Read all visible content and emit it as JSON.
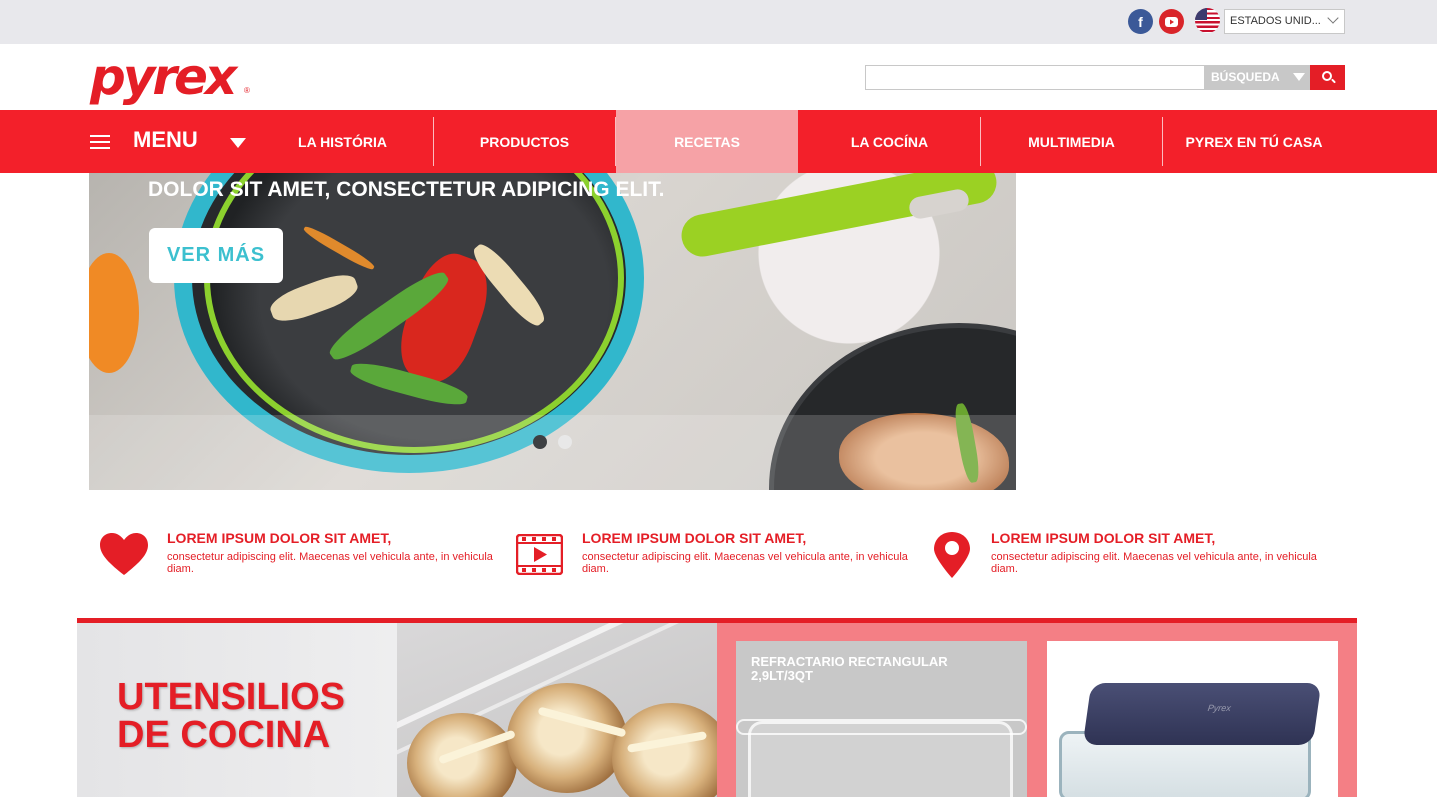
{
  "topbar": {
    "social": [
      "facebook-icon",
      "youtube-icon"
    ],
    "country_selected": "ESTADOS UNID..."
  },
  "header": {
    "logo_text": "pyrex",
    "logo_reg": "®",
    "search_placeholder": "",
    "search_type_label": "BÚSQUEDA"
  },
  "nav": {
    "menu_label": "MENU",
    "items": [
      {
        "label": "LA HISTÓRIA",
        "active": false
      },
      {
        "label": "PRODUCTOS",
        "active": false
      },
      {
        "label": "RECETAS",
        "active": true
      },
      {
        "label": "LA COCÍNA",
        "active": false
      },
      {
        "label": "MULTIMEDIA",
        "active": false
      },
      {
        "label": "PYREX EN TÚ CASA",
        "active": false
      }
    ]
  },
  "hero": {
    "headline": "DOLOR SIT AMET, CONSECTETUR ADIPICING ELIT.",
    "button_label": "VER MÁS",
    "slide_count": 2,
    "active_slide": 2
  },
  "features": [
    {
      "icon": "heart-icon",
      "title": "LOREM IPSUM DOLOR SIT AMET,",
      "text": "consectetur adipiscing elit. Maecenas vel vehicula ante, in vehicula diam."
    },
    {
      "icon": "video-icon",
      "title": "LOREM IPSUM DOLOR SIT AMET,",
      "text": "consectetur adipiscing elit. Maecenas vel vehicula ante, in vehicula diam."
    },
    {
      "icon": "map-pin-icon",
      "title": "LOREM IPSUM DOLOR SIT AMET,",
      "text": "consectetur adipiscing elit. Maecenas vel vehicula ante, in vehicula diam."
    }
  ],
  "promo": {
    "title_line1": "UTENSILIOS",
    "title_line2": "DE COCINA"
  },
  "products": [
    {
      "title": "REFRACTARIO RECTANGULAR 2,9LT/3QT"
    },
    {
      "title": ""
    }
  ],
  "colors": {
    "brand_red": "#e41e26",
    "nav_red": "#f3202a",
    "nav_active": "#f6a2a6",
    "promo_pink": "#f47f85",
    "button_text": "#3cc0cf"
  }
}
